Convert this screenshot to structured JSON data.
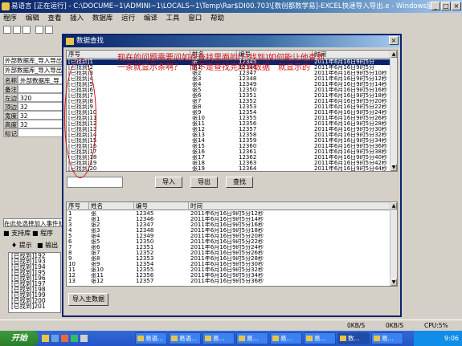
{
  "main_window": {
    "title": "易语言 [正在运行] - C:\\DOCUME~1\\ADMINI~1\\LOCALS~1\\Temp\\Rar$DI00.703\\[数创都数学易]-EXCEL快速导入导出.e - Windows窗口程...",
    "min": "_",
    "max": "□",
    "close": "×"
  },
  "menu": [
    "程序",
    "编辑",
    "查看",
    "插入",
    "数据库",
    "运行",
    "编译",
    "工具",
    "窗口",
    "帮助"
  ],
  "left_panel": {
    "combo": "外部数据库_导入导出 (外",
    "combo2": "外部数据库_导入导出",
    "props": [
      {
        "k": "名称",
        "v": "外部数据库_导入导"
      },
      {
        "k": "备注",
        "v": ""
      },
      {
        "k": "左边",
        "v": "320"
      },
      {
        "k": "顶边",
        "v": "32"
      },
      {
        "k": "宽度",
        "v": "32"
      },
      {
        "k": "高度",
        "v": "32"
      },
      {
        "k": "标记",
        "v": ""
      }
    ],
    "hint": "在此处选择加入事件处理",
    "tab1": "支持库",
    "tab2": "程序"
  },
  "bottom_panel": {
    "tab1": "提示",
    "tab2": "输出",
    "items": [
      "[已找到]192",
      "[已找到]193",
      "[已找到]194",
      "[已找到]195",
      "[已找到]196",
      "[已找到]197",
      "[已找到]198",
      "[已找到]199",
      "[已找到]200",
      "[已找到]201"
    ]
  },
  "dialog": {
    "title": "数据查找",
    "top_grid": {
      "headers": [
        "序号",
        "姓名",
        "编号",
        "时间"
      ],
      "rows": [
        [
          "[已找到]1",
          "张",
          "12345",
          "2011年6月16日9时5分"
        ],
        [
          "[已找到]2",
          "张1",
          "12346",
          "2011年6月16日9时5分"
        ],
        [
          "[已找到]3",
          "张2",
          "12347",
          "2011年6月16日9时5分10秒"
        ],
        [
          "[已找到]4",
          "张3",
          "12348",
          "2011年6月16日9时5分12秒"
        ],
        [
          "[已找到]5",
          "张4",
          "12349",
          "2011年6月16日9时5分14秒"
        ],
        [
          "[已找到]6",
          "张5",
          "12350",
          "2011年6月16日9时5分16秒"
        ],
        [
          "[已找到]7",
          "张6",
          "12351",
          "2011年6月16日9时5分18秒"
        ],
        [
          "[已找到]8",
          "张7",
          "12352",
          "2011年6月16日9时5分20秒"
        ],
        [
          "[已找到]9",
          "张8",
          "12353",
          "2011年6月16日9时5分22秒"
        ],
        [
          "[已找到]10",
          "张9",
          "12354",
          "2011年6月16日9时5分24秒"
        ],
        [
          "[已找到]11",
          "张10",
          "12355",
          "2011年6月16日9时5分26秒"
        ],
        [
          "[已找到]12",
          "张11",
          "12356",
          "2011年6月16日9时5分28秒"
        ],
        [
          "[已找到]13",
          "张12",
          "12357",
          "2011年6月16日9时5分30秒"
        ],
        [
          "[已找到]14",
          "张13",
          "12358",
          "2011年6月16日9时5分32秒"
        ],
        [
          "[已找到]15",
          "张14",
          "12359",
          "2011年6月16日9时5分34秒"
        ],
        [
          "[已找到]16",
          "张15",
          "12360",
          "2011年6月16日9时5分36秒"
        ],
        [
          "[已找到]17",
          "张16",
          "12361",
          "2011年6月16日9时5分38秒"
        ],
        [
          "[已找到]18",
          "张17",
          "12362",
          "2011年6月16日9时5分40秒"
        ],
        [
          "[已找到]19",
          "张18",
          "12363",
          "2011年6月16日9时5分42秒"
        ],
        [
          "[已找到]20",
          "张19",
          "12364",
          "2011年6月16日9时5分44秒"
        ]
      ]
    },
    "btn_import": "导入",
    "btn_export": "导出",
    "btn_find": "查找",
    "bottom_grid": {
      "headers": [
        "序号",
        "姓名",
        "编号",
        "时间"
      ],
      "rows": [
        [
          "1",
          "张",
          "12345",
          "2011年6月16日9时5分12秒"
        ],
        [
          "2",
          "张1",
          "12346",
          "2011年6月16日9时5分14秒"
        ],
        [
          "3",
          "张2",
          "12347",
          "2011年6月16日9时5分16秒"
        ],
        [
          "4",
          "张3",
          "12348",
          "2011年6月16日9时5分18秒"
        ],
        [
          "5",
          "张4",
          "12349",
          "2011年6月16日9时5分20秒"
        ],
        [
          "6",
          "张5",
          "12350",
          "2011年6月16日9时5分22秒"
        ],
        [
          "7",
          "张6",
          "12351",
          "2011年6月16日9时5分24秒"
        ],
        [
          "8",
          "张7",
          "12352",
          "2011年6月16日9时5分26秒"
        ],
        [
          "9",
          "张8",
          "12353",
          "2011年6月16日9时5分28秒"
        ],
        [
          "10",
          "张9",
          "12354",
          "2011年6月16日9时5分30秒"
        ],
        [
          "11",
          "张10",
          "12355",
          "2011年6月16日9时5分32秒"
        ],
        [
          "12",
          "张11",
          "12356",
          "2011年6月16日9时5分34秒"
        ],
        [
          "13",
          "张12",
          "12357",
          "2011年6月16日9时5分36秒"
        ]
      ]
    },
    "btn_import_main": "导入主数据"
  },
  "annotation": {
    "text": "现在的问题需要问如在查找里面的[已找到]如何能让他查到一条就显示条啊？　而不是查找完所有数据　就显示的",
    "color": "#d01010"
  },
  "statusbar": {
    "rx": "0KB/S",
    "tx": "0KB/S",
    "cpu": "CPU:5%"
  },
  "taskbar": {
    "start": "开始",
    "items": [
      "易语...",
      "易语...",
      "易...",
      "易...",
      "易...",
      "易...",
      "数...",
      "易..."
    ],
    "clock": "9:06"
  }
}
